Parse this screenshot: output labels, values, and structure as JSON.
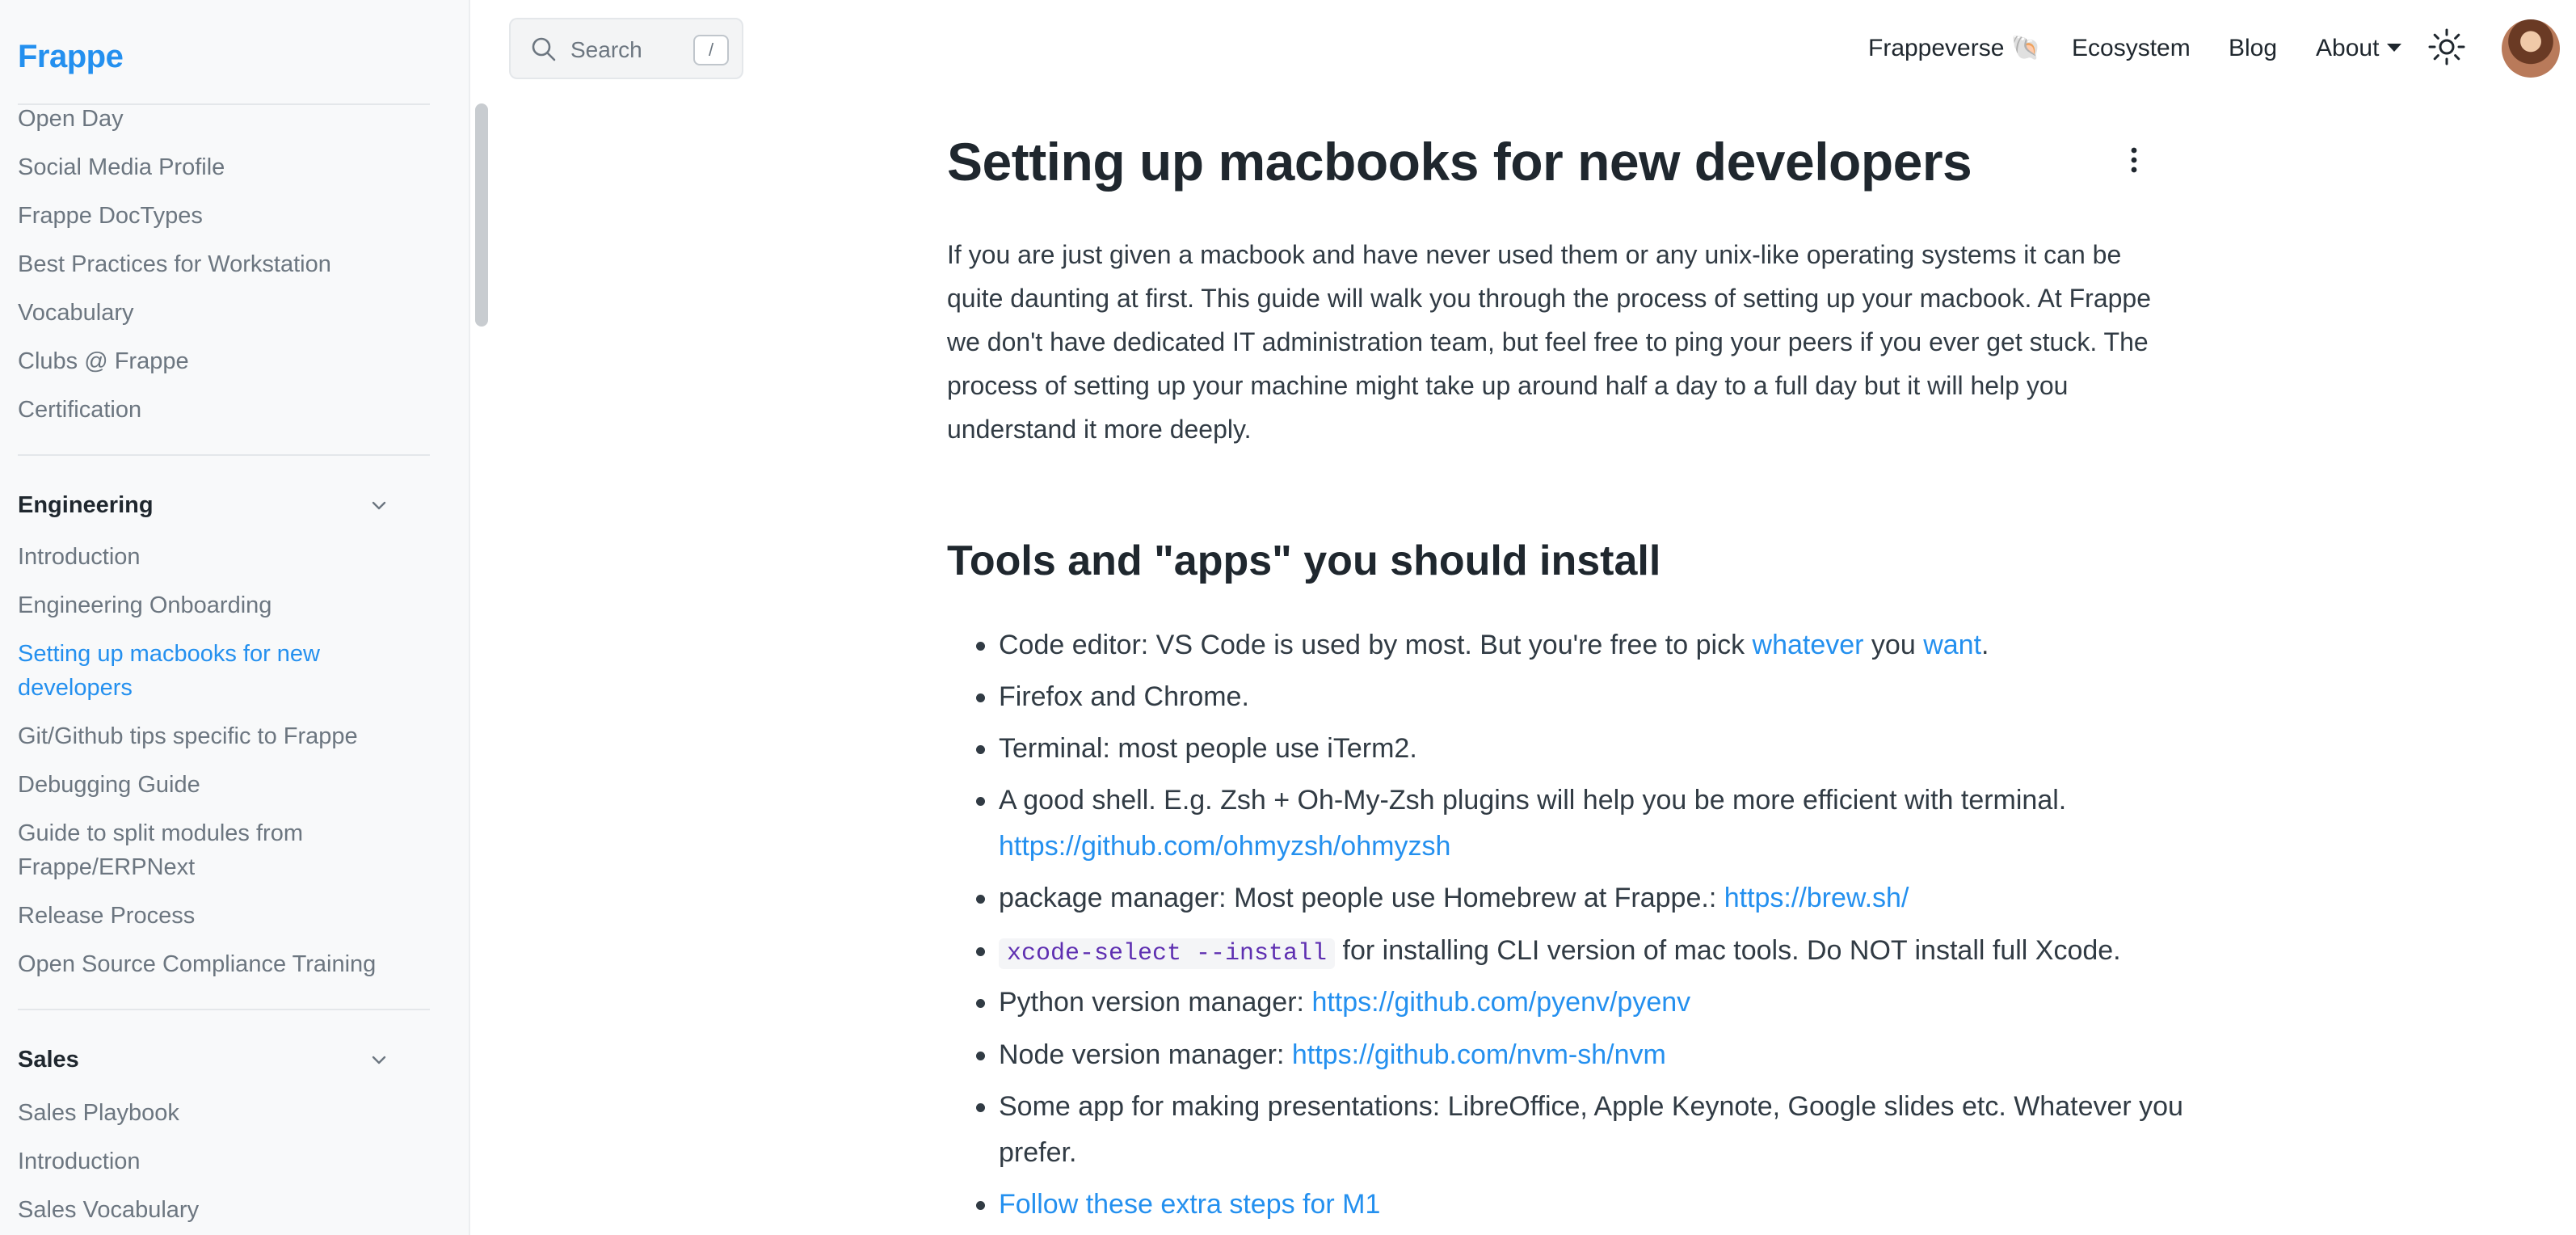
{
  "brand": {
    "logo_text": "Frappe",
    "accent": "#2490ef"
  },
  "search": {
    "label": "Search",
    "shortcut": "/"
  },
  "topnav": {
    "items": [
      {
        "label": "Frappeverse 🐚"
      },
      {
        "label": "Ecosystem"
      },
      {
        "label": "Blog"
      },
      {
        "label": "About"
      }
    ]
  },
  "sidebar": {
    "prev_items": [
      "Open Day",
      "Social Media Profile",
      "Frappe DocTypes",
      "Best Practices for Workstation",
      "Vocabulary",
      "Clubs @ Frappe",
      "Certification"
    ],
    "engineering": {
      "title": "Engineering",
      "items": [
        "Introduction",
        "Engineering Onboarding",
        "Setting up macbooks for new developers",
        "Git/Github tips specific to Frappe",
        "Debugging Guide",
        "Guide to split modules from Frappe/ERPNext",
        "Release Process",
        "Open Source Compliance Training"
      ],
      "active_index": 2
    },
    "sales": {
      "title": "Sales",
      "items": [
        "Sales Playbook",
        "Introduction",
        "Sales Vocabulary"
      ]
    }
  },
  "article": {
    "title": "Setting up macbooks for new developers",
    "intro": "If you are just given a macbook and have never used them or any unix-like operating systems it can be quite daunting at first. This guide will walk you through the process of setting up your macbook. At Frappe we don't have dedicated IT administration team, but feel free to ping your peers if you ever get stuck. The process of setting up your machine might take up around half a day to a full day but it will help you understand it more deeply.",
    "section_title": "Tools and \"apps\" you should install",
    "list": {
      "i0_a": "Code editor: VS Code is used by most. But you're free to pick ",
      "i0_link1": "whatever",
      "i0_b": " you ",
      "i0_link2": "want",
      "i0_c": ".",
      "i1": "Firefox and Chrome.",
      "i2": "Terminal: most people use iTerm2.",
      "i3_a": "A good shell. E.g. Zsh + Oh-My-Zsh plugins will help you be more efficient with terminal.",
      "i3_link": "https://github.com/ohmyzsh/ohmyzsh",
      "i4_a": "package manager: Most people use Homebrew at Frappe.: ",
      "i4_link": "https://brew.sh/",
      "i5_code": "xcode-select --install",
      "i5_b": " for installing CLI version of mac tools. Do NOT install full Xcode.",
      "i6_a": "Python version manager: ",
      "i6_link": "https://github.com/pyenv/pyenv",
      "i7_a": "Node version manager: ",
      "i7_link": "https://github.com/nvm-sh/nvm",
      "i8": "Some app for making presentations: LibreOffice, Apple Keynote, Google slides etc. Whatever you prefer.",
      "i9_link": "Follow these extra steps for M1"
    }
  }
}
